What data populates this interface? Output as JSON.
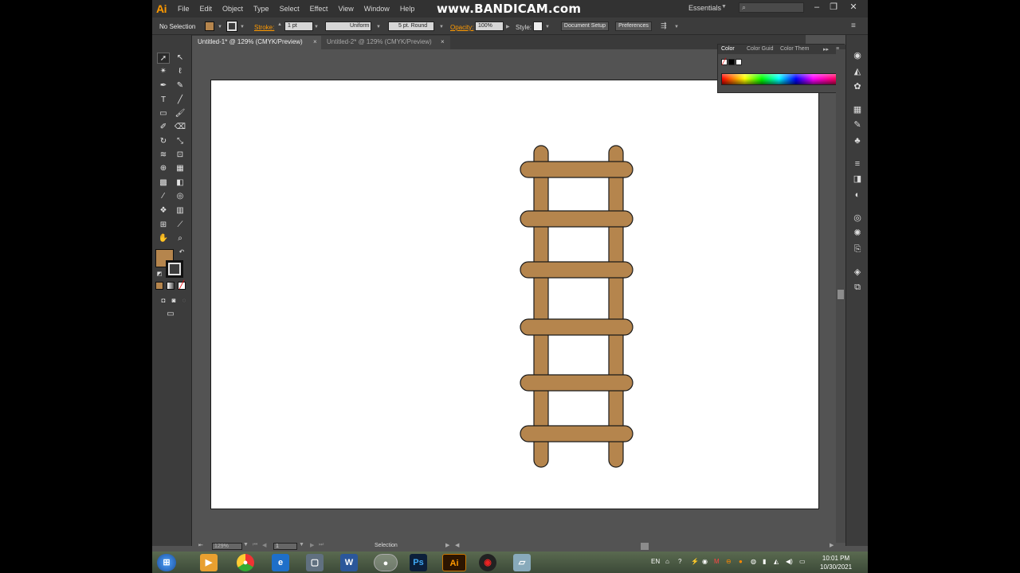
{
  "app": {
    "logo": "Ai",
    "watermark": "www.BANDICAM.com",
    "workspace": "Essentials"
  },
  "menu": [
    "File",
    "Edit",
    "Object",
    "Type",
    "Select",
    "Effect",
    "View",
    "Window",
    "Help"
  ],
  "control_bar": {
    "selection_label": "No Selection",
    "stroke_label": "Stroke:",
    "stroke_weight": "1 pt",
    "variable_width": "Uniform",
    "brush": "5 pt. Round",
    "opacity_label": "Opacity:",
    "opacity_value": "100%",
    "style_label": "Style:",
    "document_setup": "Document Setup",
    "preferences": "Preferences"
  },
  "tabs": [
    {
      "label": "Untitled-1* @ 129% (CMYK/Preview)",
      "active": true
    },
    {
      "label": "Untitled-2* @ 129% (CMYK/Preview)",
      "active": false
    }
  ],
  "color_panel": {
    "tabs": [
      "Color",
      "Color Guid",
      "Color Them"
    ]
  },
  "colors": {
    "fill": "#b5854d",
    "stroke": "#1a1a1a",
    "accent": "#ff9a00"
  },
  "status": {
    "zoom": "129%",
    "page": "1",
    "tool": "Selection"
  },
  "taskbar": {
    "language": "EN",
    "time": "10:01 PM",
    "date": "10/30/2021",
    "apps": [
      "start",
      "media-player",
      "chrome",
      "internet-explorer",
      "explorer",
      "word",
      "chrome-active",
      "photoshop",
      "illustrator",
      "recorder",
      "tablet"
    ]
  },
  "artwork": {
    "type": "ladder",
    "rails": 2,
    "rungs": 6
  }
}
